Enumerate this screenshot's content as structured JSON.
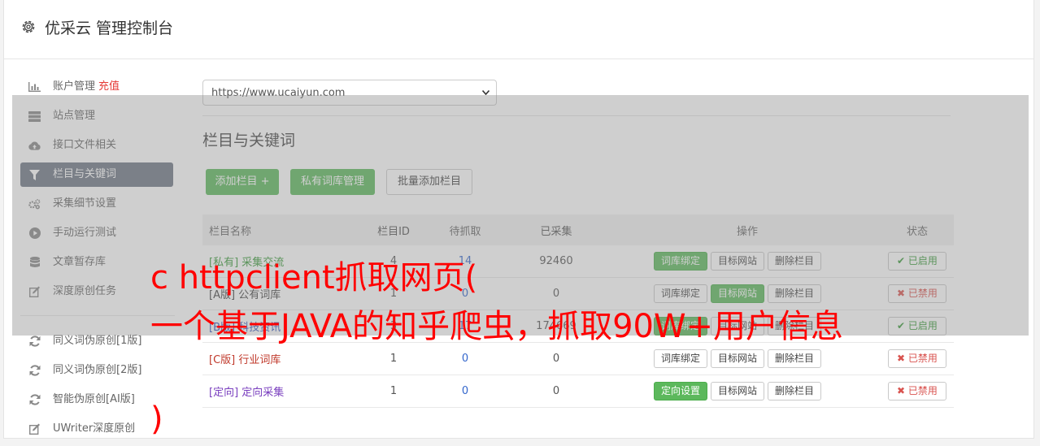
{
  "header": {
    "title": "优采云 管理控制台"
  },
  "sidebar": {
    "items": [
      {
        "label": "账户管理",
        "extra": "充值",
        "icon": "bar-chart-icon"
      },
      {
        "label": "站点管理",
        "icon": "server-icon"
      },
      {
        "label": "接口文件相关",
        "icon": "cloud-upload-icon"
      },
      {
        "label": "栏目与关键词",
        "icon": "filter-icon",
        "active": true
      },
      {
        "label": "采集细节设置",
        "icon": "cogs-icon"
      },
      {
        "label": "手动运行测试",
        "icon": "play-circle-icon"
      },
      {
        "label": "文章暂存库",
        "icon": "database-icon"
      },
      {
        "label": "深度原创任务",
        "icon": "edit-icon"
      },
      {
        "label": "同义词伪原创[1版]",
        "icon": "refresh-icon"
      },
      {
        "label": "同义词伪原创[2版]",
        "icon": "refresh-icon"
      },
      {
        "label": "智能伪原创[AI版]",
        "icon": "refresh-icon"
      },
      {
        "label": "UWriter深度原创",
        "icon": "edit-icon"
      }
    ]
  },
  "main": {
    "site_select": "https://www.ucaiyun.com",
    "section_title": "栏目与关键词",
    "buttons": {
      "add": "添加栏目 +",
      "private": "私有词库管理",
      "batch": "批量添加栏目"
    },
    "table": {
      "headers": {
        "name": "栏目名称",
        "id": "栏目ID",
        "pending": "待抓取",
        "done": "已采集",
        "ops": "操作",
        "status": "状态"
      },
      "rows": [
        {
          "tag": "[私有]",
          "name": "采集交流",
          "id": "4",
          "pending": "14",
          "done": "92460",
          "op1": "词库绑定",
          "op2": "目标网站",
          "op3": "删除栏目",
          "status": "已启用"
        },
        {
          "tag": "[A版]",
          "name": "公有词库",
          "id": "1",
          "pending": "0",
          "done": "0",
          "op1": "词库绑定",
          "op2": "目标网站",
          "op3": "删除栏目",
          "status": "已禁用"
        },
        {
          "tag": "[B版]",
          "name": "科技资讯",
          "id": "3",
          "pending": "17",
          "done": "174669",
          "op1": "词库绑定",
          "op2": "目标网站",
          "op3": "删除栏目",
          "status": "已启用"
        },
        {
          "tag": "[C版]",
          "name": "行业词库",
          "id": "1",
          "pending": "0",
          "done": "0",
          "op1": "词库绑定",
          "op2": "目标网站",
          "op3": "删除栏目",
          "status": "已禁用"
        },
        {
          "tag": "[定向]",
          "name": "定向采集",
          "id": "1",
          "pending": "0",
          "done": "0",
          "op1": "定向设置",
          "op2": "目标网站",
          "op3": "删除栏目",
          "status": "已禁用"
        }
      ]
    }
  },
  "overlay": {
    "line1": "c httpclient抓取网页(",
    "line2": "一个基于JAVA的知乎爬虫，抓取90W+用户信息",
    "line3": ")"
  },
  "colors": {
    "accent_green": "#5cb85c",
    "sidebar_active": "#6f7886",
    "overlay_text": "#ff0000",
    "recharge": "#e53935"
  }
}
